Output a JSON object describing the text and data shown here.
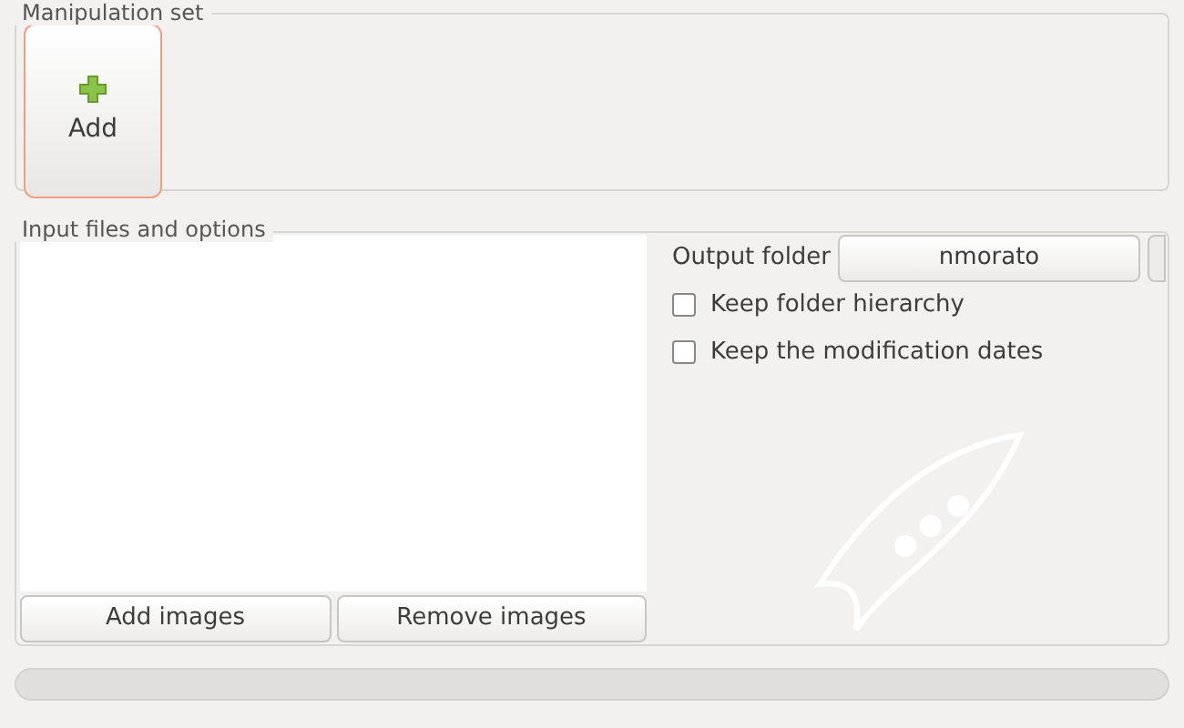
{
  "manipulation_set": {
    "title": "Manipulation set",
    "add_button": {
      "label": "Add",
      "focused": true
    }
  },
  "input": {
    "title": "Input files and options",
    "list_buttons": [
      "Add images",
      "Remove images"
    ],
    "output_folder": {
      "label": "Output folder",
      "value": "nmorato"
    },
    "options": [
      {
        "label": "Keep folder hierarchy",
        "checked": false
      },
      {
        "label": "Keep the modification dates",
        "checked": false
      }
    ]
  },
  "progress": {
    "level": 0
  }
}
